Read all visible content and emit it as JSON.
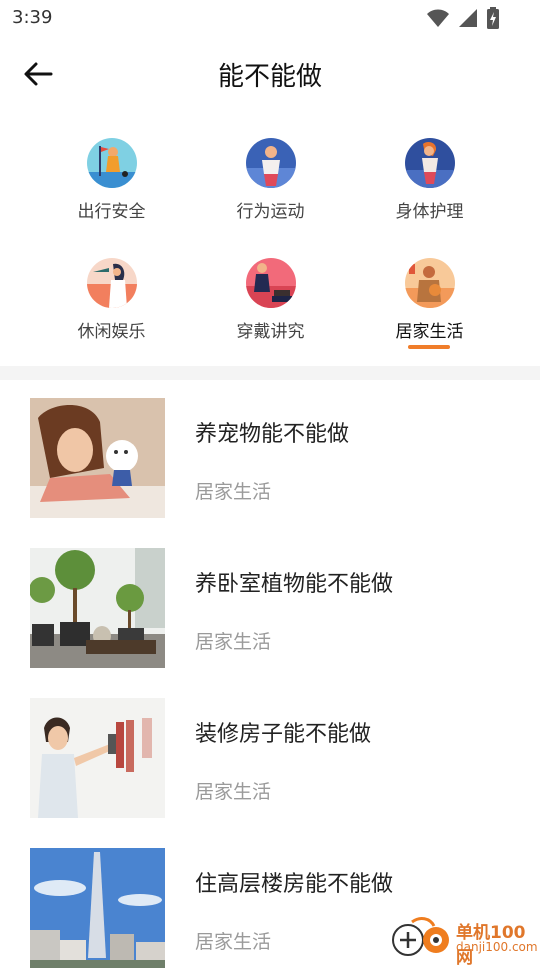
{
  "status": {
    "time": "3:39"
  },
  "header": {
    "title": "能不能做"
  },
  "categories": [
    {
      "label": "出行安全"
    },
    {
      "label": "行为运动"
    },
    {
      "label": "身体护理"
    },
    {
      "label": "休闲娱乐"
    },
    {
      "label": "穿戴讲究"
    },
    {
      "label": "居家生活",
      "active": true
    }
  ],
  "items": [
    {
      "title": "养宠物能不能做",
      "tag": "居家生活"
    },
    {
      "title": "养卧室植物能不能做",
      "tag": "居家生活"
    },
    {
      "title": "装修房子能不能做",
      "tag": "居家生活"
    },
    {
      "title": "住高层楼房能不能做",
      "tag": "居家生活"
    }
  ],
  "watermark": {
    "name": "单机100网",
    "domain": "danji100.com"
  },
  "colors": {
    "accent": "#f07d2a",
    "muted_text": "#9a9a9a",
    "divider": "#f4f4f4"
  }
}
